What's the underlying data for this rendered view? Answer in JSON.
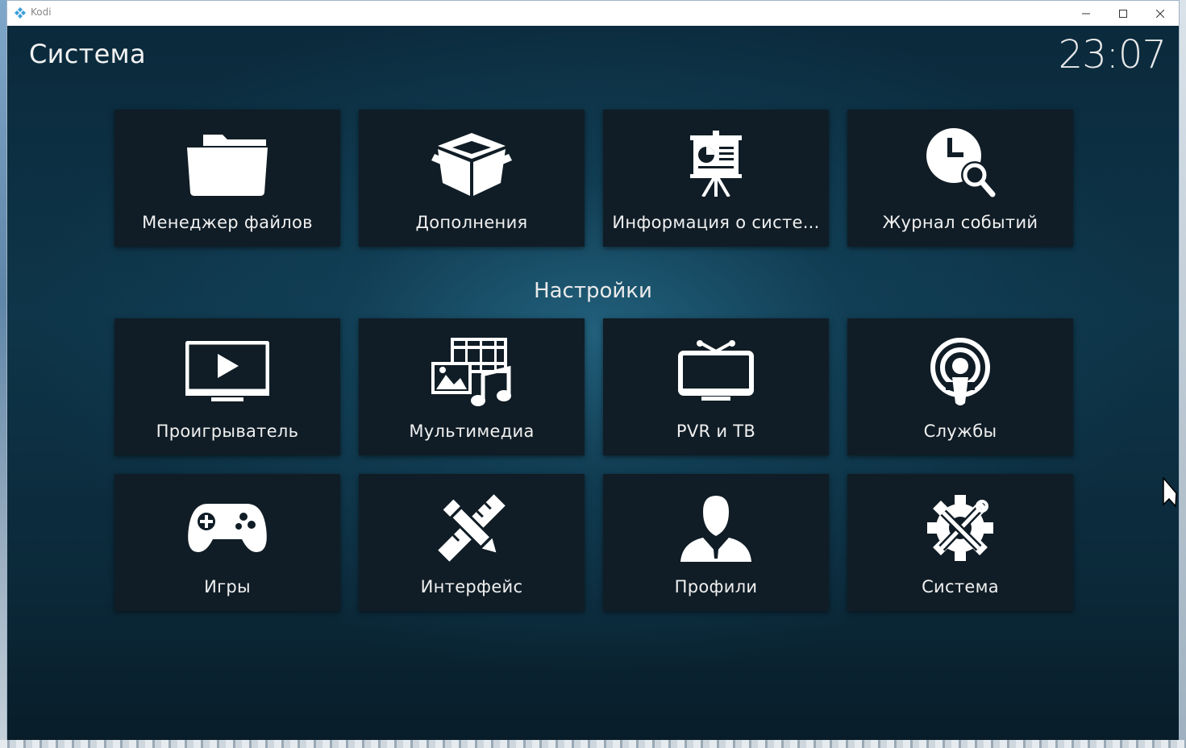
{
  "window": {
    "title": "Kodi"
  },
  "header": {
    "title": "Система",
    "clock": "23:07"
  },
  "sections": {
    "settings_label": "Настройки"
  },
  "tiles": [
    {
      "label": "Менеджер файлов",
      "icon": "folder-icon"
    },
    {
      "label": "Дополнения",
      "icon": "box-icon"
    },
    {
      "label": "Информация о систе...",
      "icon": "presentation-board-icon"
    },
    {
      "label": "Журнал событий",
      "icon": "clock-search-icon"
    },
    {
      "label": "Проигрыватель",
      "icon": "monitor-play-icon"
    },
    {
      "label": "Мультимедиа",
      "icon": "media-icon"
    },
    {
      "label": "PVR и ТВ",
      "icon": "tv-icon"
    },
    {
      "label": "Службы",
      "icon": "broadcast-icon"
    },
    {
      "label": "Игры",
      "icon": "gamepad-icon"
    },
    {
      "label": "Интерфейс",
      "icon": "pencil-ruler-icon"
    },
    {
      "label": "Профили",
      "icon": "user-profile-icon"
    },
    {
      "label": "Система",
      "icon": "gear-tools-icon"
    }
  ],
  "colors": {
    "tile_bg": "#101d26",
    "background": "#0e3549",
    "text": "#f0f0f0"
  }
}
